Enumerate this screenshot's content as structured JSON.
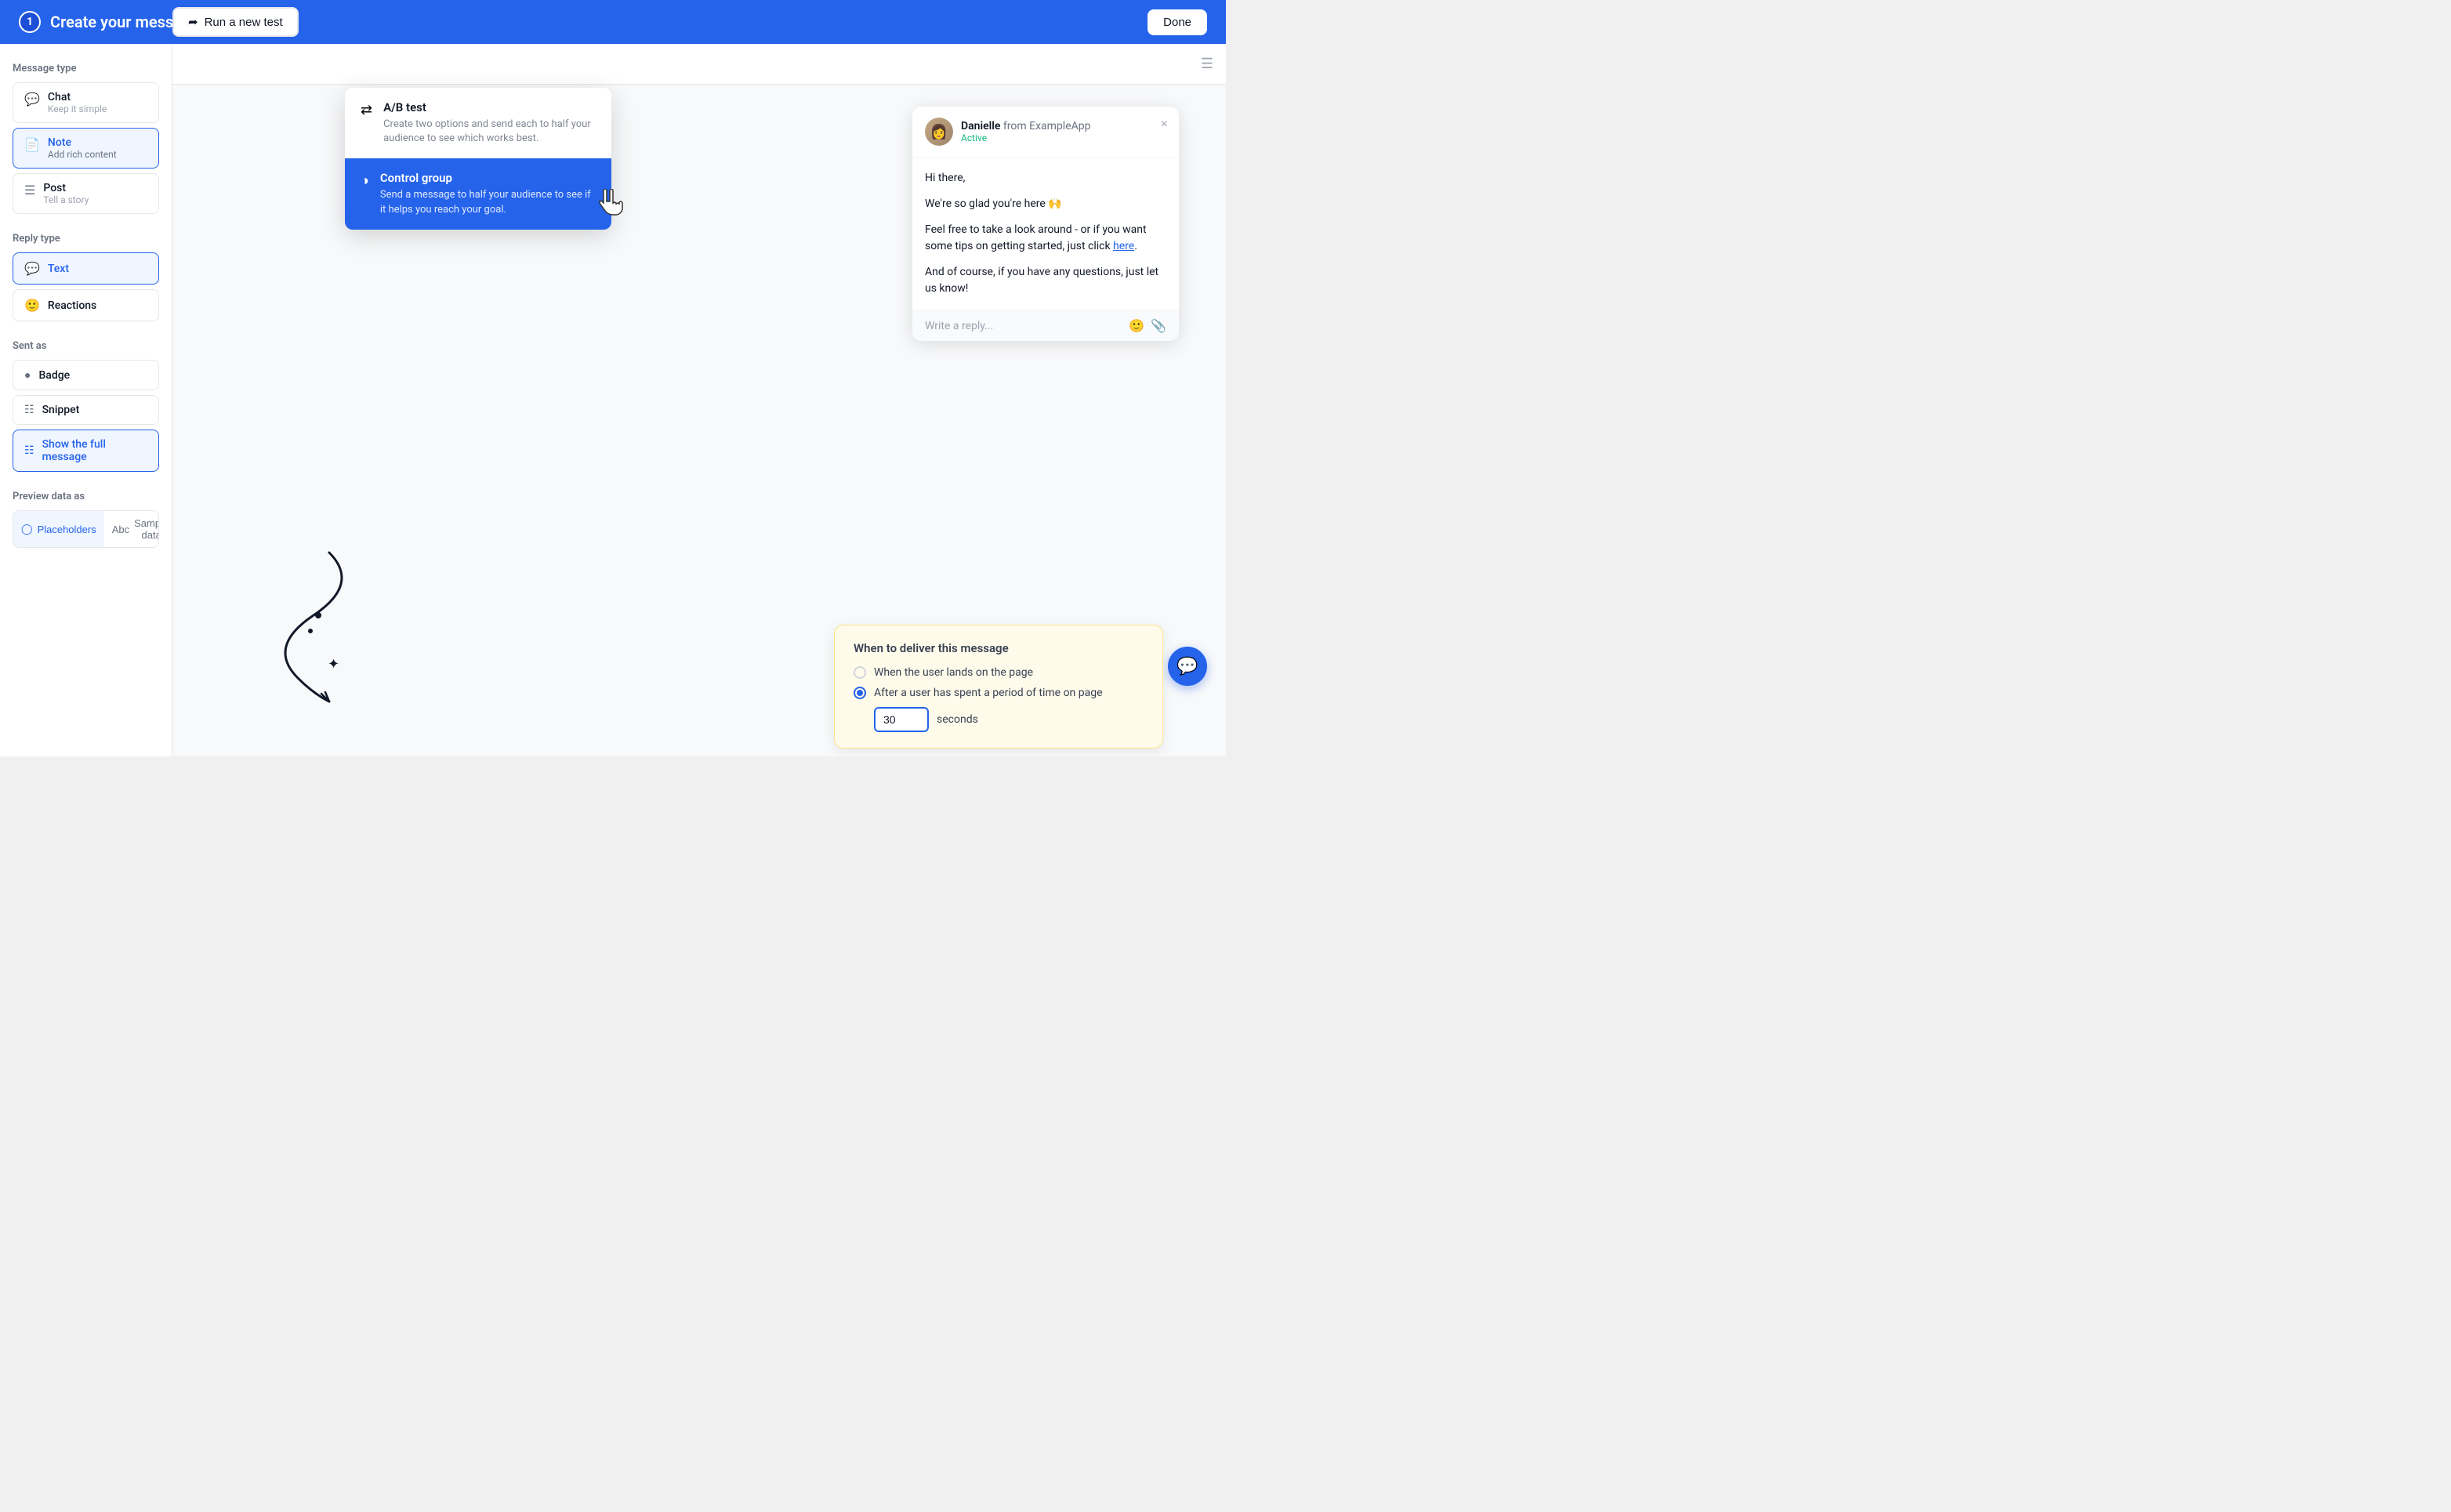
{
  "header": {
    "step": "1",
    "title": "Create your message",
    "run_test_label": "Run a new test",
    "done_label": "Done"
  },
  "sidebar": {
    "message_type_label": "Message type",
    "message_types": [
      {
        "id": "chat",
        "name": "Chat",
        "desc": "Keep it simple",
        "active": false
      },
      {
        "id": "note",
        "name": "Note",
        "desc": "Add rich content",
        "active": true
      },
      {
        "id": "post",
        "name": "Post",
        "desc": "Tell a story",
        "active": false
      }
    ],
    "reply_type_label": "Reply type",
    "reply_types": [
      {
        "id": "text",
        "name": "Text",
        "active": true
      },
      {
        "id": "reactions",
        "name": "Reactions",
        "active": false
      }
    ],
    "sent_as_label": "Sent as",
    "sent_as_options": [
      {
        "id": "badge",
        "name": "Badge",
        "active": false
      },
      {
        "id": "snippet",
        "name": "Snippet",
        "active": false
      },
      {
        "id": "full",
        "name": "Show the full message",
        "active": true
      }
    ],
    "preview_label": "Preview data as",
    "preview_options": [
      {
        "id": "placeholders",
        "name": "Placeholders",
        "active": true
      },
      {
        "id": "sample",
        "name": "Sample data",
        "active": false
      }
    ]
  },
  "dropdown": {
    "items": [
      {
        "id": "ab-test",
        "title": "A/B test",
        "desc": "Create two options and send each to half your audience to see which works best.",
        "highlighted": false
      },
      {
        "id": "control-group",
        "title": "Control group",
        "desc": "Send a message to half your audience to see if it helps you reach your goal.",
        "highlighted": true
      }
    ]
  },
  "chat_preview": {
    "sender": "Danielle",
    "company": "from ExampleApp",
    "status": "Active",
    "close_label": "×",
    "messages": [
      "Hi there,",
      "We're so glad you're here 🙌",
      "Feel free to take a look around - or if you want some tips on getting started, just click here.",
      "And of course, if you have any questions, just let us know!"
    ],
    "reply_placeholder": "Write a reply...",
    "link_text": "here"
  },
  "delivery_panel": {
    "title": "When to deliver this message",
    "options": [
      {
        "id": "on-page-land",
        "label": "When the user lands on the page",
        "checked": false
      },
      {
        "id": "after-time",
        "label": "After a user has spent a period of time on page",
        "checked": true
      }
    ],
    "seconds_value": "30",
    "seconds_label": "seconds"
  }
}
